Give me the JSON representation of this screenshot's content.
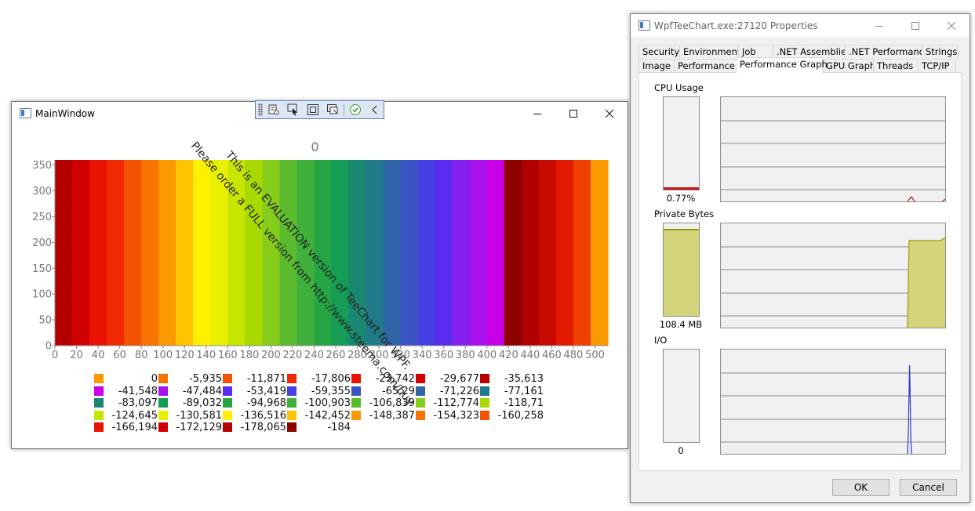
{
  "main_window": {
    "title": "MainWindow",
    "minimize_label": "—",
    "maximize_label": "☐",
    "close_label": "✕"
  },
  "toolbar": {
    "icons": [
      "select-tool-icon",
      "pointer-icon",
      "frame-icon",
      "layout-icon",
      "check-icon",
      "chevron-left-icon"
    ]
  },
  "chart_data": {
    "type": "heatmap",
    "title": "0",
    "x_ticks": [
      "0",
      "20",
      "40",
      "60",
      "80",
      "100",
      "120",
      "140",
      "160",
      "180",
      "200",
      "220",
      "240",
      "260",
      "280",
      "300",
      "320",
      "340",
      "360",
      "380",
      "400",
      "420",
      "440",
      "460",
      "480",
      "500"
    ],
    "y_ticks": [
      "0",
      "50",
      "100",
      "150",
      "200",
      "250",
      "300",
      "350"
    ],
    "xlim": [
      0,
      512
    ],
    "ylim": [
      0,
      360
    ],
    "bands": [
      {
        "x0": 0,
        "x1": 16,
        "color": "#b50000"
      },
      {
        "x0": 16,
        "x1": 32,
        "color": "#d10000"
      },
      {
        "x0": 32,
        "x1": 48,
        "color": "#ea1200"
      },
      {
        "x0": 48,
        "x1": 64,
        "color": "#ef2a00"
      },
      {
        "x0": 64,
        "x1": 80,
        "color": "#f35200"
      },
      {
        "x0": 80,
        "x1": 96,
        "color": "#f87400"
      },
      {
        "x0": 96,
        "x1": 112,
        "color": "#fb9a00"
      },
      {
        "x0": 112,
        "x1": 128,
        "color": "#ffc400"
      },
      {
        "x0": 128,
        "x1": 144,
        "color": "#fff000"
      },
      {
        "x0": 144,
        "x1": 160,
        "color": "#e8f000"
      },
      {
        "x0": 160,
        "x1": 176,
        "color": "#c6e600"
      },
      {
        "x0": 176,
        "x1": 192,
        "color": "#a8da00"
      },
      {
        "x0": 192,
        "x1": 208,
        "color": "#86cc1a"
      },
      {
        "x0": 208,
        "x1": 224,
        "color": "#5cba2e"
      },
      {
        "x0": 224,
        "x1": 240,
        "color": "#40b03c"
      },
      {
        "x0": 240,
        "x1": 256,
        "color": "#25a544"
      },
      {
        "x0": 256,
        "x1": 272,
        "color": "#159c55"
      },
      {
        "x0": 272,
        "x1": 288,
        "color": "#1a8870"
      },
      {
        "x0": 288,
        "x1": 304,
        "color": "#207a8a"
      },
      {
        "x0": 304,
        "x1": 320,
        "color": "#2f66a8"
      },
      {
        "x0": 320,
        "x1": 336,
        "color": "#3a52c4"
      },
      {
        "x0": 336,
        "x1": 352,
        "color": "#4440e4"
      },
      {
        "x0": 352,
        "x1": 368,
        "color": "#5a2cf0"
      },
      {
        "x0": 368,
        "x1": 384,
        "color": "#8420f0"
      },
      {
        "x0": 384,
        "x1": 400,
        "color": "#a812ee"
      },
      {
        "x0": 400,
        "x1": 416,
        "color": "#c800e8"
      },
      {
        "x0": 416,
        "x1": 432,
        "color": "#8c0000"
      },
      {
        "x0": 432,
        "x1": 448,
        "color": "#b20000"
      },
      {
        "x0": 448,
        "x1": 464,
        "color": "#c80a00"
      },
      {
        "x0": 464,
        "x1": 480,
        "color": "#e11a00"
      },
      {
        "x0": 480,
        "x1": 496,
        "color": "#f04000"
      },
      {
        "x0": 496,
        "x1": 512,
        "color": "#fb9a00"
      }
    ],
    "legend": [
      {
        "label": "0",
        "color": "#fb9a00"
      },
      {
        "label": "-5,935",
        "color": "#f87400"
      },
      {
        "label": "-11,871",
        "color": "#f35200"
      },
      {
        "label": "-17,806",
        "color": "#ef2a00"
      },
      {
        "label": "-23,742",
        "color": "#ea1200"
      },
      {
        "label": "-29,677",
        "color": "#d10000"
      },
      {
        "label": "-35,613",
        "color": "#b50000"
      },
      {
        "label": "-41,548",
        "color": "#c800e8"
      },
      {
        "label": "-47,484",
        "color": "#a812ee"
      },
      {
        "label": "-53,419",
        "color": "#5a2cf0"
      },
      {
        "label": "-59,355",
        "color": "#4440e4"
      },
      {
        "label": "-65,29",
        "color": "#3a52c4"
      },
      {
        "label": "-71,226",
        "color": "#2f66a8"
      },
      {
        "label": "-77,161",
        "color": "#207a8a"
      },
      {
        "label": "-83,097",
        "color": "#1a8870"
      },
      {
        "label": "-89,032",
        "color": "#159c55"
      },
      {
        "label": "-94,968",
        "color": "#25a544"
      },
      {
        "label": "-100,903",
        "color": "#40b03c"
      },
      {
        "label": "-106,839",
        "color": "#5cba2e"
      },
      {
        "label": "-112,774",
        "color": "#86cc1a"
      },
      {
        "label": "-118,71",
        "color": "#a8da00"
      },
      {
        "label": "-124,645",
        "color": "#c6e600"
      },
      {
        "label": "-130,581",
        "color": "#e8f000"
      },
      {
        "label": "-136,516",
        "color": "#fff000"
      },
      {
        "label": "-142,452",
        "color": "#ffc400"
      },
      {
        "label": "-148,387",
        "color": "#fb9a00"
      },
      {
        "label": "-154,323",
        "color": "#f87400"
      },
      {
        "label": "-160,258",
        "color": "#f35200"
      },
      {
        "label": "-166,194",
        "color": "#ea1200"
      },
      {
        "label": "-172,129",
        "color": "#d10000"
      },
      {
        "label": "-178,065",
        "color": "#b50000"
      },
      {
        "label": "-184",
        "color": "#8c0000"
      }
    ],
    "grid": false
  },
  "watermark": {
    "line1": "This is an EVALUATION version of TeeChart for WPF.",
    "line2": "Please order a FULL version from http://www.steema.com/buy"
  },
  "properties_window": {
    "title": "WpfTeeChart.exe:27120 Properties",
    "tabs_row1": [
      "Security",
      "Environment",
      "Job",
      ".NET Assemblies",
      ".NET Performance",
      "Strings"
    ],
    "tabs_row2": [
      "Image",
      "Performance",
      "Performance Graph",
      "GPU Graph",
      "Threads",
      "TCP/IP"
    ],
    "active_tab": "Performance Graph",
    "cpu": {
      "label": "CPU Usage",
      "value": "0.77%",
      "level": 0.0077
    },
    "private_bytes": {
      "label": "Private Bytes",
      "value": "108.4 MB",
      "level": 0.92
    },
    "io": {
      "label": "I/O",
      "value": "0",
      "level": 0
    },
    "ok_label": "OK",
    "cancel_label": "Cancel",
    "colors": {
      "cpu": "#c01818",
      "private_bytes_fill": "#d4d47a",
      "private_bytes_line": "#9a9a00",
      "io": "#2a3cc8"
    }
  }
}
